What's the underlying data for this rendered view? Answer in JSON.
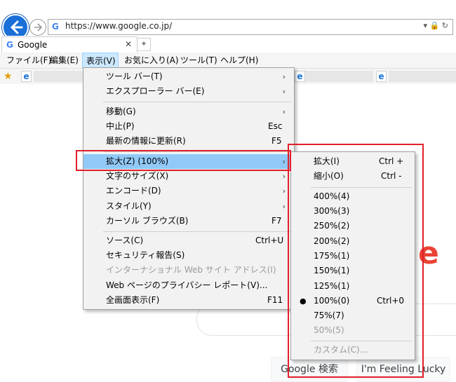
{
  "browser": {
    "url": "https://www.google.co.jp/",
    "tab_title": "Google",
    "tab_favicon": "G",
    "new_tab_glyph": "✦"
  },
  "menubar": {
    "items": [
      {
        "label": "ファイル(F)"
      },
      {
        "label": "編集(E)"
      },
      {
        "label": "表示(V)"
      },
      {
        "label": "お気に入り(A)"
      },
      {
        "label": "ツール(T)"
      },
      {
        "label": "ヘルプ(H)"
      }
    ]
  },
  "view_menu": {
    "items": [
      {
        "label": "ツール バー(T)",
        "shortcut": "",
        "submenu": true
      },
      {
        "label": "エクスプローラー バー(E)",
        "shortcut": "",
        "submenu": true
      },
      {
        "label": "移動(G)",
        "shortcut": "",
        "submenu": true
      },
      {
        "label": "中止(P)",
        "shortcut": "Esc",
        "submenu": false
      },
      {
        "label": "最新の情報に更新(R)",
        "shortcut": "F5",
        "submenu": false
      },
      {
        "label": "拡大(Z) (100%)",
        "shortcut": "",
        "submenu": true
      },
      {
        "label": "文字のサイズ(X)",
        "shortcut": "",
        "submenu": true
      },
      {
        "label": "エンコード(D)",
        "shortcut": "",
        "submenu": true
      },
      {
        "label": "スタイル(Y)",
        "shortcut": "",
        "submenu": true
      },
      {
        "label": "カーソル ブラウズ(B)",
        "shortcut": "F7",
        "submenu": false
      },
      {
        "label": "ソース(C)",
        "shortcut": "Ctrl+U",
        "submenu": false
      },
      {
        "label": "セキュリティ報告(S)",
        "shortcut": "",
        "submenu": false
      },
      {
        "label": "インターナショナル Web サイト アドレス(I)",
        "shortcut": "",
        "submenu": false
      },
      {
        "label": "Web ページのプライバシー レポート(V)...",
        "shortcut": "",
        "submenu": false
      },
      {
        "label": "全画面表示(F)",
        "shortcut": "F11",
        "submenu": false
      }
    ]
  },
  "zoom_menu": {
    "items": [
      {
        "label": "拡大(I)",
        "shortcut": "Ctrl +"
      },
      {
        "label": "縮小(O)",
        "shortcut": "Ctrl -"
      },
      {
        "label": "400%(4)",
        "shortcut": ""
      },
      {
        "label": "300%(3)",
        "shortcut": ""
      },
      {
        "label": "250%(2)",
        "shortcut": ""
      },
      {
        "label": "200%(2)",
        "shortcut": ""
      },
      {
        "label": "175%(1)",
        "shortcut": ""
      },
      {
        "label": "150%(1)",
        "shortcut": ""
      },
      {
        "label": "125%(1)",
        "shortcut": ""
      },
      {
        "label": "100%(0)",
        "shortcut": "Ctrl+0"
      },
      {
        "label": "75%(7)",
        "shortcut": ""
      },
      {
        "label": "50%(5)",
        "shortcut": ""
      },
      {
        "label": "カスタム(C)...",
        "shortcut": ""
      }
    ],
    "selected_bullet": "●"
  },
  "page": {
    "logo_letter": "e",
    "search_button": "Google 検索",
    "lucky_button": "I'm Feeling Lucky"
  },
  "colors": {
    "highlight": "#91c9f7",
    "annotation_red": "#e0202a"
  }
}
